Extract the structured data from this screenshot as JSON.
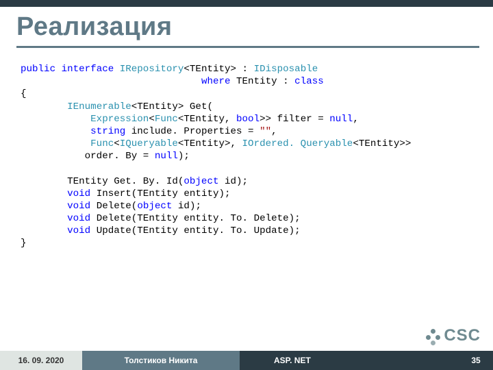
{
  "title": "Реализация",
  "code": {
    "l1a": "public",
    "l1b": " ",
    "l1c": "interface",
    "l1d": " ",
    "l1e": "IRepository",
    "l1f": "<TEntity> : ",
    "l1g": "IDisposable",
    "l2a": "                               ",
    "l2b": "where",
    "l2c": " TEntity : ",
    "l2d": "class",
    "l3": "{",
    "l4a": "        ",
    "l4b": "IEnumerable",
    "l4c": "<TEntity> Get(",
    "l5a": "            ",
    "l5b": "Expression",
    "l5c": "<",
    "l5d": "Func",
    "l5e": "<TEntity, ",
    "l5f": "bool",
    "l5g": ">> filter = ",
    "l5h": "null",
    "l5i": ",",
    "l6a": "            ",
    "l6b": "string",
    "l6c": " include. Properties = ",
    "l6d": "\"\"",
    "l6e": ",",
    "l7a": "            ",
    "l7b": "Func",
    "l7c": "<",
    "l7d": "IQueryable",
    "l7e": "<TEntity>, ",
    "l7f": "IOrdered. Queryable",
    "l7g": "<TEntity>>",
    "l8a": "           order. By = ",
    "l8b": "null",
    "l8c": ");",
    "l9": "",
    "l10a": "        TEntity Get. By. Id(",
    "l10b": "object",
    "l10c": " id);",
    "l11a": "        ",
    "l11b": "void",
    "l11c": " Insert(TEntity entity);",
    "l12a": "        ",
    "l12b": "void",
    "l12c": " Delete(",
    "l12d": "object",
    "l12e": " id);",
    "l13a": "        ",
    "l13b": "void",
    "l13c": " Delete(TEntity entity. To. Delete);",
    "l14a": "        ",
    "l14b": "void",
    "l14c": " Update(TEntity entity. To. Update);",
    "l15": "}"
  },
  "footer": {
    "date": "16. 09. 2020",
    "author": "Толстиков Никита",
    "topic": "ASP. NET",
    "page": "35"
  },
  "logo": "CSC"
}
